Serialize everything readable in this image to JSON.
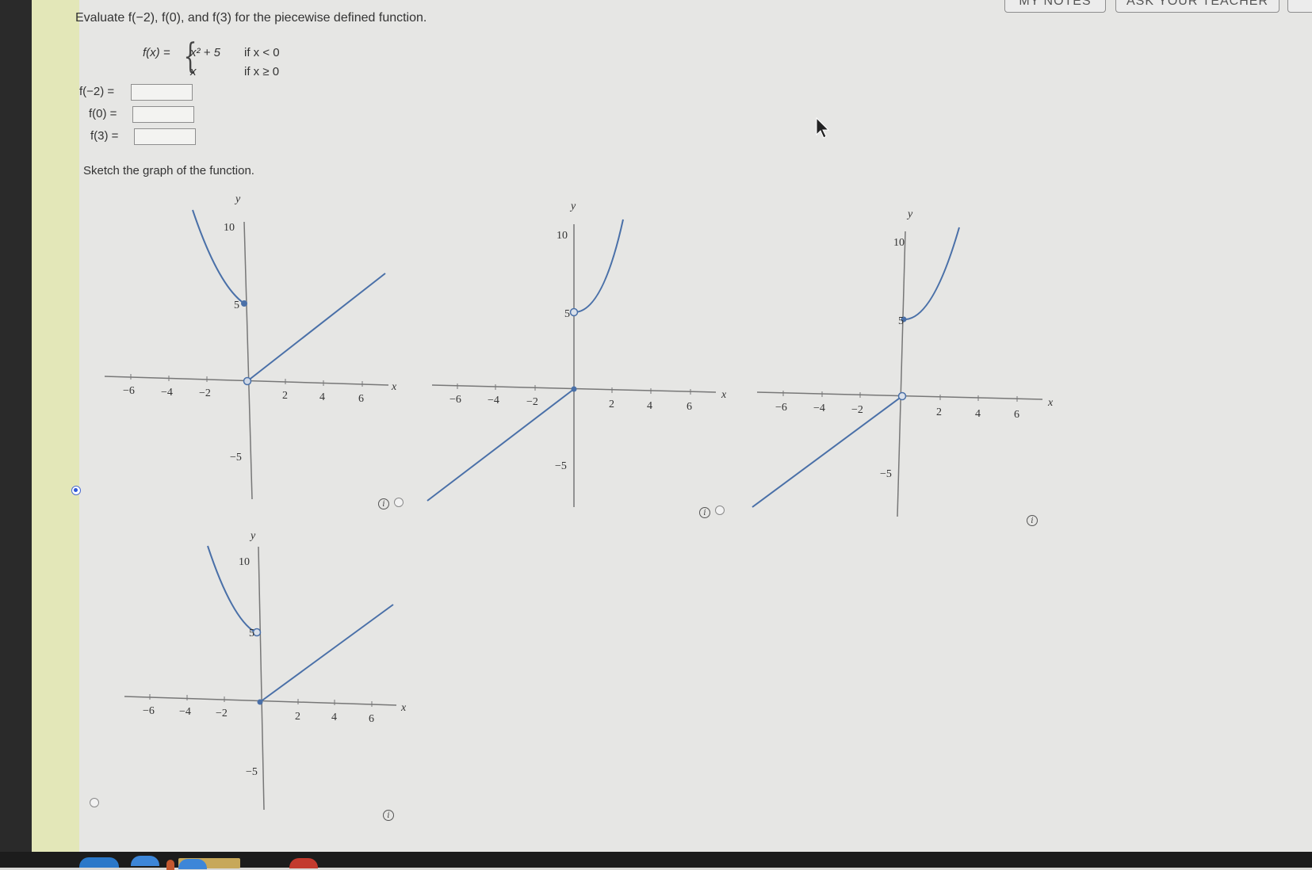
{
  "header": {
    "notes_label": "MY NOTES",
    "ask_label": "ASK YOUR TEACHER"
  },
  "question": {
    "intro": "Evaluate f(−2), f(0), and f(3) for the piecewise defined function.",
    "function_name": "f(x) =",
    "case1_expr": "x² + 5",
    "case1_cond": "if x < 0",
    "case2_expr": "x",
    "case2_cond": "if x ≥ 0"
  },
  "answers": [
    {
      "label": "f(−2) =",
      "value": ""
    },
    {
      "label": "f(0) =",
      "value": ""
    },
    {
      "label": "f(3) =",
      "value": ""
    }
  ],
  "sketch_prompt": "Sketch the graph of the function.",
  "graph_labels": {
    "x_axis": "x",
    "y_axis": "y",
    "x_ticks": [
      "−6",
      "−4",
      "−2",
      "2",
      "4",
      "6"
    ],
    "y_ticks": [
      "10",
      "5",
      "−5"
    ]
  },
  "options": [
    {
      "id": "A",
      "selected": true,
      "description_visible": "parabola left of 0 with line y = x for x ≥ 0"
    },
    {
      "id": "B",
      "selected": false,
      "description_visible": "line for x < 0 with parabola for x ≥ 0"
    },
    {
      "id": "C",
      "selected": false,
      "description_visible": "line for x < 0 with parabola for x ≥ 0"
    },
    {
      "id": "D",
      "selected": false,
      "description_visible": "parabola left of 0 with line y = x for x ≥ 0"
    }
  ],
  "colors": {
    "curve": "#4a70a8",
    "radio_selected": "#2d57d8",
    "sidebar": "#e3e7b8"
  }
}
